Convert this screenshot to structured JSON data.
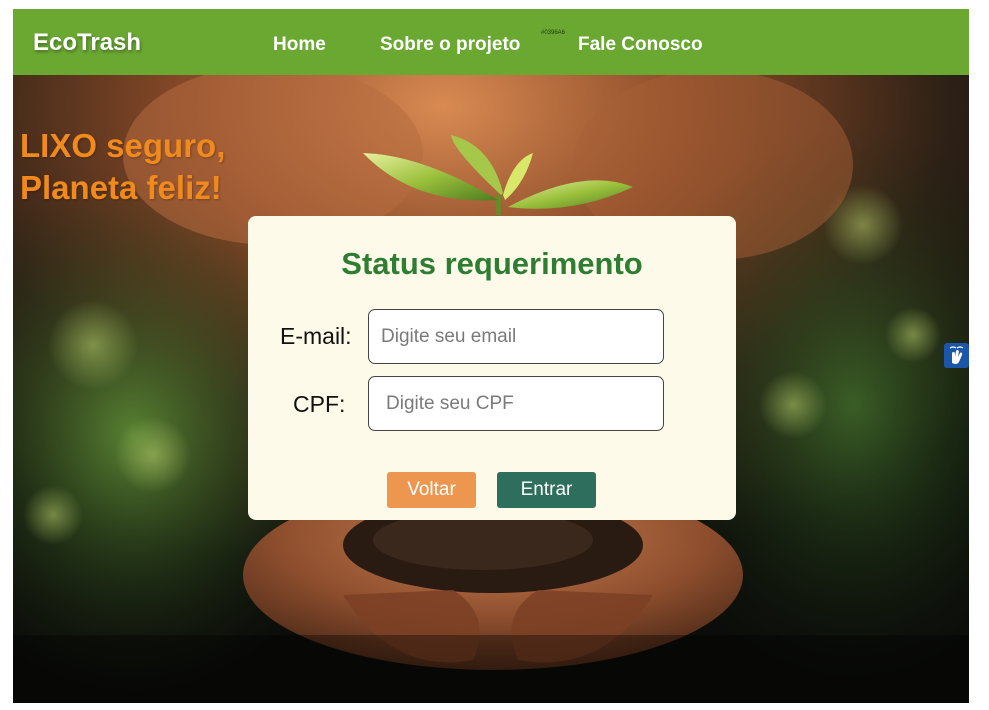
{
  "header": {
    "brand": "EcoTrash",
    "nav": {
      "home": "Home",
      "about": "Sobre o projeto",
      "contact": "Fale Conosco"
    },
    "color_note": "#0396A6",
    "bg_color": "#6aa832"
  },
  "hero": {
    "tagline_line1": "LIXO seguro,",
    "tagline_line2": "Planeta feliz!",
    "tagline_color": "#f08a1c",
    "image": "hands-holding-soil-with-sprout"
  },
  "form": {
    "title": "Status requerimento",
    "email_label": "E-mail:",
    "email_placeholder": "Digite seu email",
    "email_value": "",
    "cpf_label": "CPF:",
    "cpf_placeholder": "Digite seu CPF",
    "cpf_value": "",
    "back_label": "Voltar",
    "enter_label": "Entrar"
  },
  "widgets": {
    "accessibility_icon": "sign-language-icon"
  }
}
